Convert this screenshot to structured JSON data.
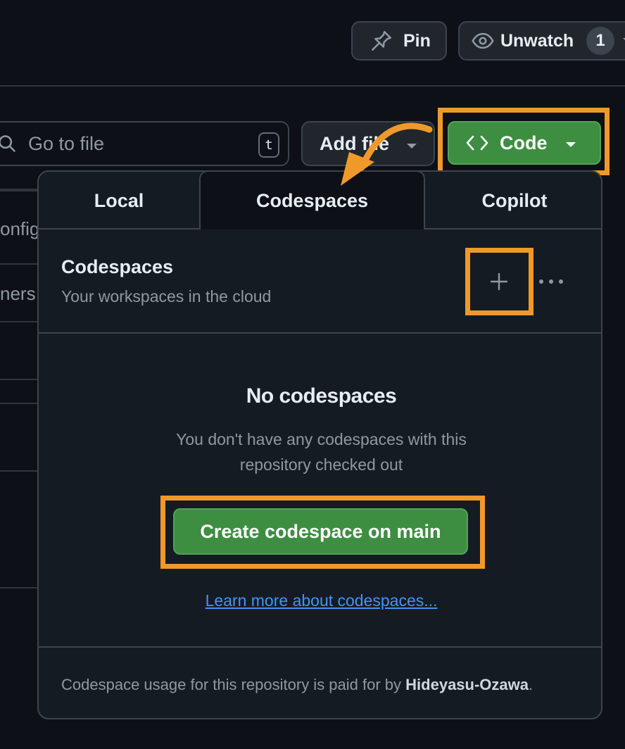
{
  "header": {
    "pin_label": "Pin",
    "unwatch_label": "Unwatch",
    "watch_count": "1"
  },
  "toolbar": {
    "goto_placeholder": "Go to file",
    "goto_shortcut": "t",
    "add_file_label": "Add file",
    "code_label": "Code"
  },
  "background": {
    "row_fragment_1": "onfig",
    "row_fragment_2": "ners"
  },
  "popup": {
    "tabs": [
      {
        "label": "Local"
      },
      {
        "label": "Codespaces"
      },
      {
        "label": "Copilot"
      }
    ],
    "section_title": "Codespaces",
    "section_subtitle": "Your workspaces in the cloud",
    "empty_title": "No codespaces",
    "empty_description": "You don't have any codespaces with this repository checked out",
    "create_button_label": "Create codespace on main",
    "learn_more_link": "Learn more about codespaces...",
    "footer_prefix": "Codespace usage for this repository is paid for by ",
    "footer_owner": "Hideyasu-Ozawa",
    "footer_suffix": "."
  },
  "colors": {
    "highlight": "#f0992b",
    "primary_green": "#3d8e41",
    "link_blue": "#4493f8",
    "background": "#0d1117",
    "panel": "#151b23"
  },
  "icons": [
    "pin-icon",
    "eye-icon",
    "search-icon",
    "code-brackets-icon",
    "plus-icon",
    "kebab-icon",
    "caret-down-icon",
    "annotation-arrow"
  ]
}
